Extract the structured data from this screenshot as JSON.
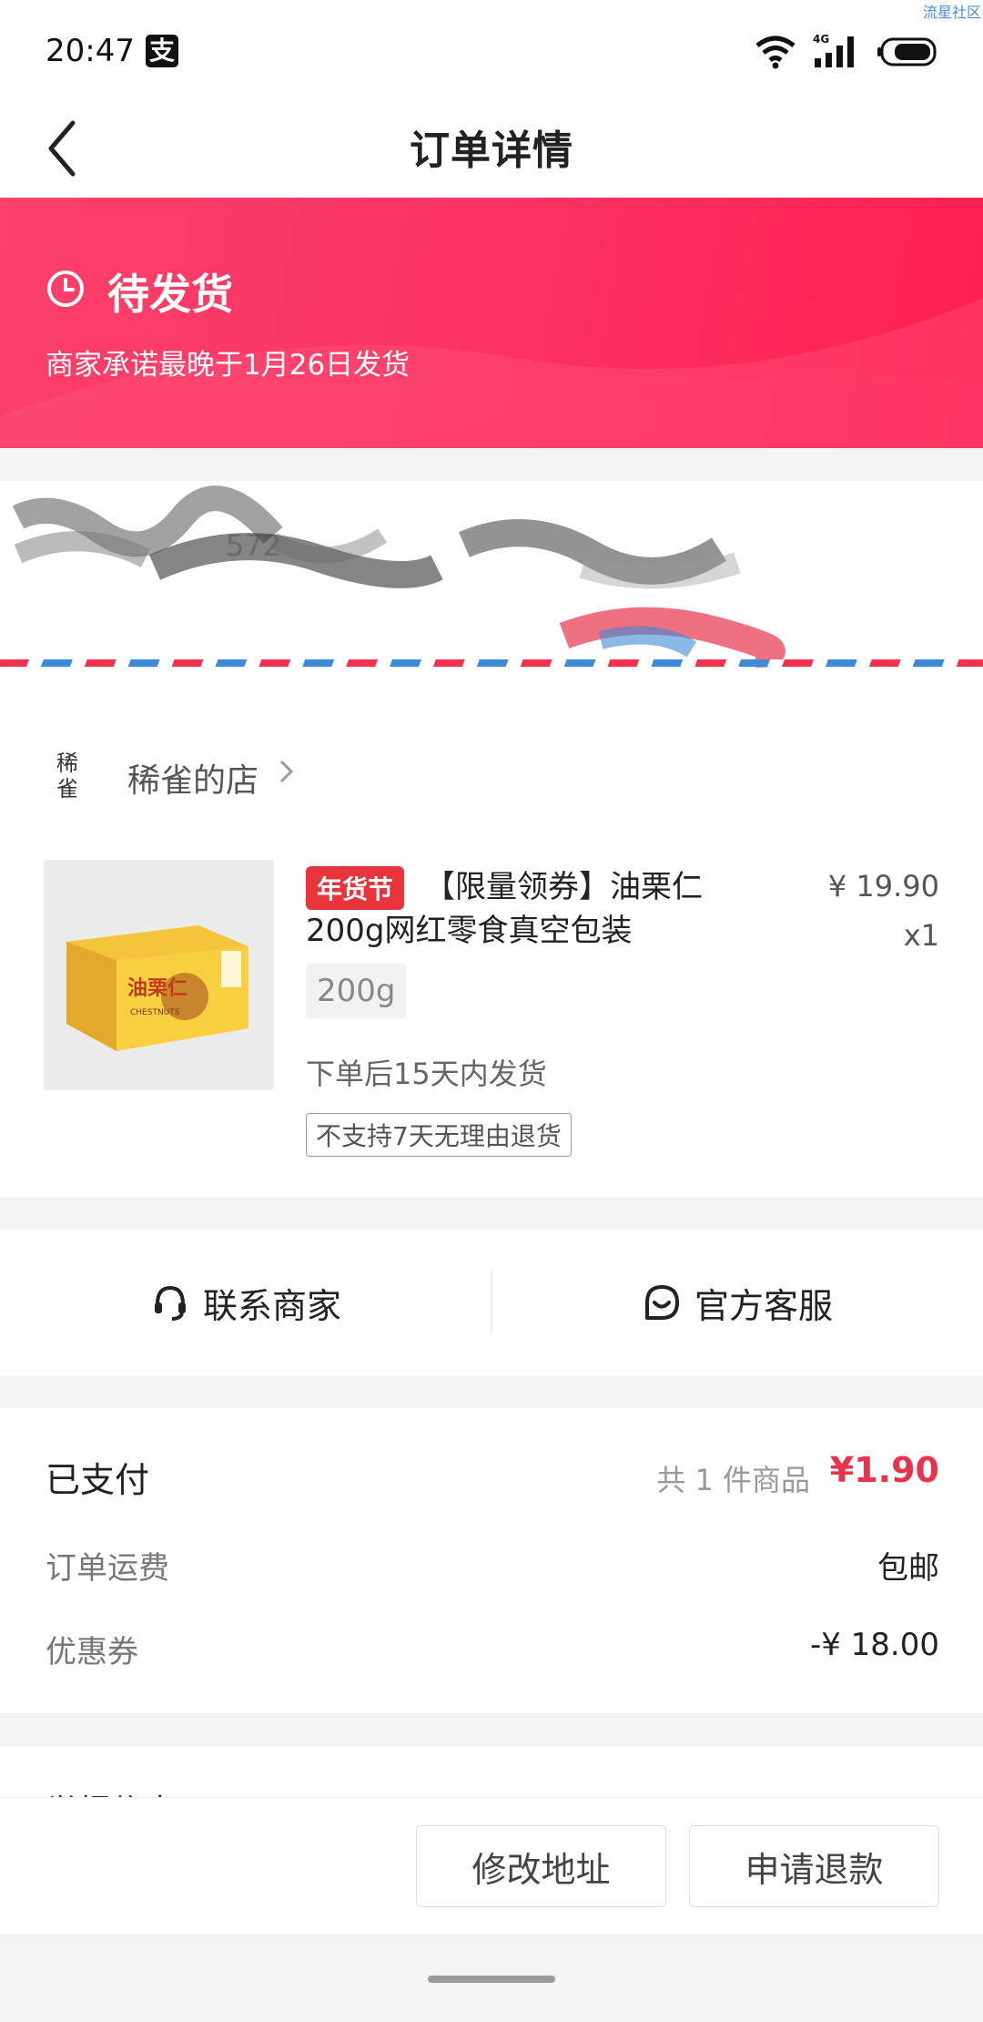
{
  "statusbar": {
    "time": "20:47",
    "alipay_glyph": "支",
    "network": "4G",
    "watermark": "流星社区"
  },
  "navbar": {
    "title": "订单详情"
  },
  "order_status": {
    "title": "待发货",
    "subtitle": "商家承诺最晚于1月26日发货",
    "gradient": [
      "#fa4169",
      "#ff1f4f"
    ]
  },
  "address": {
    "phone_partial": "572"
  },
  "shop": {
    "logo_text": "稀\n雀",
    "name": "稀雀的店"
  },
  "product": {
    "tag": "年货节",
    "title": "【限量领券】油栗仁200g网红零食真空包装",
    "price": "¥ 19.90",
    "quantity": "x1",
    "spec": "200g",
    "ship_note": "下单后15天内发货",
    "return_policy": "不支持7天无理由退货",
    "thumb_label": "油栗仁",
    "thumb_sub": "CHESTNUTS"
  },
  "contact": {
    "merchant_label": "联系商家",
    "official_label": "官方客服"
  },
  "payment": {
    "label": "已支付",
    "count": "共 1 件商品",
    "amount": "¥1.90",
    "shipping_label": "订单运费",
    "shipping_value": "包邮",
    "coupon_label": "优惠券",
    "coupon_value": "-¥ 18.00"
  },
  "next_section": {
    "title": "举报信息"
  },
  "actions": {
    "modify_address": "修改地址",
    "refund": "申请退款"
  },
  "colors": {
    "accent": "#e8334c",
    "tag": "#e8343b"
  }
}
